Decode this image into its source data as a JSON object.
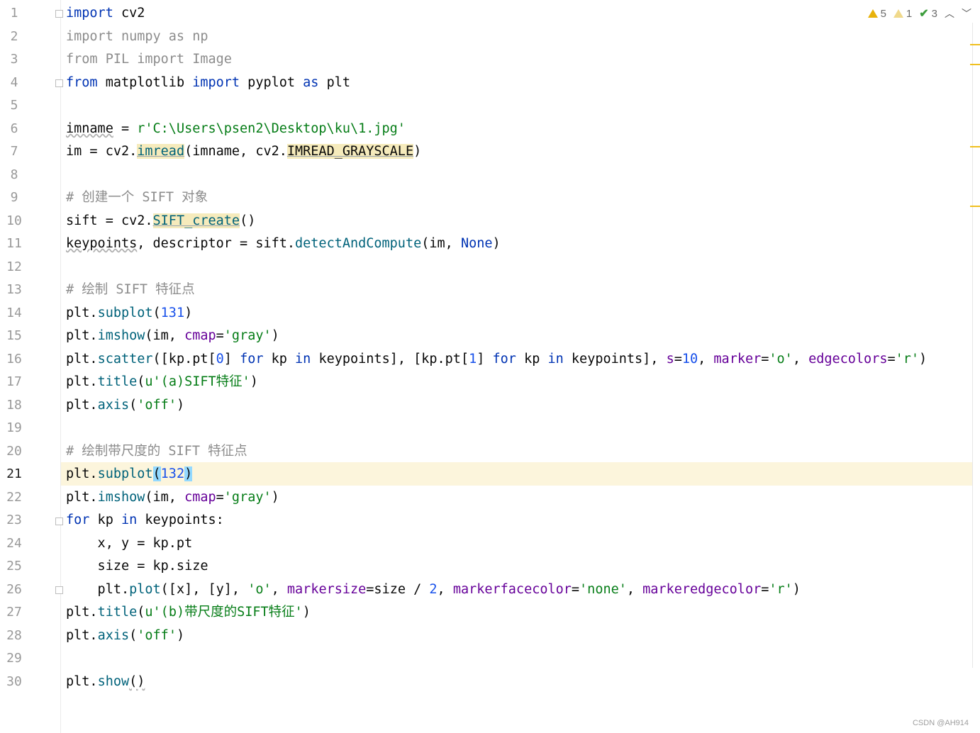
{
  "editor": {
    "status": {
      "warnings": "5",
      "weak_warnings": "1",
      "typos": "3"
    },
    "current_line": "21",
    "line_numbers": [
      "1",
      "2",
      "3",
      "4",
      "5",
      "6",
      "7",
      "8",
      "9",
      "10",
      "11",
      "12",
      "13",
      "14",
      "15",
      "16",
      "17",
      "18",
      "19",
      "20",
      "21",
      "22",
      "23",
      "24",
      "25",
      "26",
      "27",
      "28",
      "29",
      "30"
    ],
    "lines": {
      "l1": [
        "import",
        " cv2"
      ],
      "l2": [
        "import numpy as np"
      ],
      "l3": [
        "from PIL import Image"
      ],
      "l4": [
        "from",
        " matplotlib ",
        "import",
        " pyplot ",
        "as",
        " plt"
      ],
      "l6": [
        "imname",
        " = ",
        "r'C:\\Users\\psen2\\Desktop\\ku\\1.jpg'"
      ],
      "l7": [
        "im = cv2.",
        "imread",
        "(imname, cv2.",
        "IMREAD_GRAYSCALE",
        ")"
      ],
      "l9": [
        "# 创建一个 SIFT 对象"
      ],
      "l10": [
        "sift = cv2.",
        "SIFT_create",
        "()"
      ],
      "l11": [
        "keypoints",
        ", descriptor = sift.",
        "detectAndCompute",
        "(im, ",
        "None",
        ")"
      ],
      "l13": [
        "# 绘制 SIFT 特征点"
      ],
      "l14": [
        "plt.",
        "subplot",
        "(",
        "131",
        ")"
      ],
      "l15": [
        "plt.",
        "imshow",
        "(im, ",
        "cmap",
        "=",
        "'gray'",
        ")"
      ],
      "l16": [
        "plt.",
        "scatter",
        "([kp.pt[",
        "0",
        "] ",
        "for",
        " kp ",
        "in",
        " keypoints], [kp.pt[",
        "1",
        "] ",
        "for",
        " kp ",
        "in",
        " keypoints], ",
        "s",
        "=",
        "10",
        ", ",
        "marker",
        "=",
        "'o'",
        ", ",
        "edgecolors",
        "=",
        "'r'",
        ")"
      ],
      "l17": [
        "plt.",
        "title",
        "(",
        "u'(a)SIFT特征'",
        ")"
      ],
      "l18": [
        "plt.",
        "axis",
        "(",
        "'off'",
        ")"
      ],
      "l20": [
        "# 绘制带尺度的 SIFT 特征点"
      ],
      "l21": [
        "plt.",
        "subplot",
        "(",
        "132",
        ")"
      ],
      "l22": [
        "plt.",
        "imshow",
        "(im, ",
        "cmap",
        "=",
        "'gray'",
        ")"
      ],
      "l23": [
        "for",
        " kp ",
        "in",
        " keypoints:"
      ],
      "l24": [
        "    x, y = kp.pt"
      ],
      "l25": [
        "    size = kp.size"
      ],
      "l26": [
        "    plt.",
        "plot",
        "([x], [y], ",
        "'o'",
        ", ",
        "markersize",
        "=size / ",
        "2",
        ", ",
        "markerfacecolor",
        "=",
        "'none'",
        ", ",
        "markeredgecolor",
        "=",
        "'r'",
        ")"
      ],
      "l27": [
        "plt.",
        "title",
        "(",
        "u'(b)带尺度的SIFT特征'",
        ")"
      ],
      "l28": [
        "plt.",
        "axis",
        "(",
        "'off'",
        ")"
      ],
      "l30": [
        "plt.",
        "show",
        "()"
      ]
    }
  },
  "watermark": "CSDN @AH914"
}
